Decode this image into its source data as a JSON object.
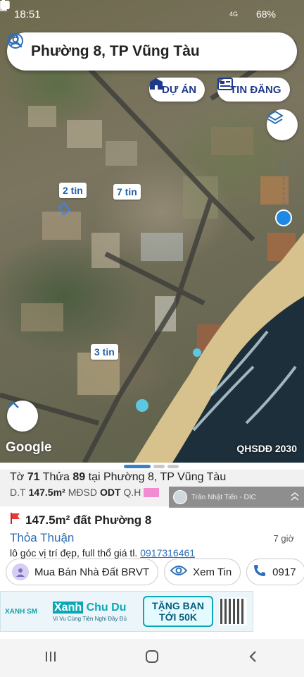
{
  "status_bar": {
    "time": "18:51",
    "signal": "4G",
    "battery": "68%"
  },
  "search": {
    "text": "Phường 8, TP Vũng Tàu"
  },
  "map_buttons": {
    "du_an": "DỰ ÁN",
    "tin_dang": "TIN ĐĂNG"
  },
  "markers": [
    {
      "label": "2 tin"
    },
    {
      "label": "7 tin"
    },
    {
      "label": "3 tin"
    }
  ],
  "map_footer": {
    "google": "Google",
    "layer_label": "QHSDĐ 2030"
  },
  "parcel": {
    "prefix": "Tờ",
    "to_so": "71",
    "thua_label": "Thửa",
    "thua_so": "89",
    "tai": "tại Phường 8, TP Vũng Tàu",
    "dt_label": "D.T",
    "dt_value": "147.5m²",
    "mdsd_label": "MĐSD",
    "mdsd_value": "ODT",
    "qh_label": "Q.H"
  },
  "agent": {
    "name": "Trần Nhật Tiến - DIC"
  },
  "listing": {
    "title": "147.5m² đất Phường 8",
    "price": "Thỏa Thuận",
    "time": "7 giờ",
    "desc": "lô góc vị trí đẹp, full thổ giá tl.",
    "phone": "0917316461"
  },
  "actions": {
    "seller": "Mua Bán Nhà Đất BRVT",
    "view": "Xem Tin",
    "call": "0917"
  },
  "ad": {
    "brand": "XANH SM",
    "headline_hl": "Xanh",
    "headline_rest": " Chu Du",
    "tagline": "Vi Vu Cùng Tiện Nghi Đầy Đủ",
    "offer_line1": "TẶNG BẠN",
    "offer_line2": "TỚI 50K"
  },
  "colors": {
    "accent_blue": "#2d6fb8",
    "navy": "#1e3a8a",
    "pink_qh": "#f08ccf",
    "location_dot": "#1e88e5"
  }
}
